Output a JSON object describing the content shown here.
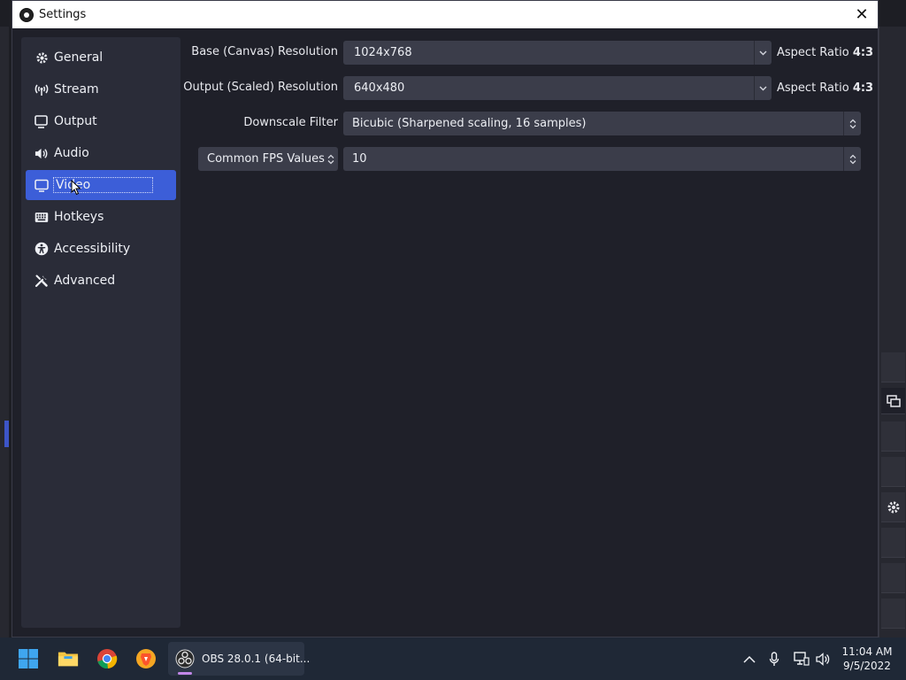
{
  "dialog": {
    "title": "Settings",
    "close_label": "✕"
  },
  "sidebar": {
    "items": [
      {
        "label": "General",
        "icon": "gear-icon"
      },
      {
        "label": "Stream",
        "icon": "broadcast-icon"
      },
      {
        "label": "Output",
        "icon": "output-icon"
      },
      {
        "label": "Audio",
        "icon": "speaker-icon"
      },
      {
        "label": "Video",
        "icon": "monitor-icon",
        "active": true
      },
      {
        "label": "Hotkeys",
        "icon": "keyboard-icon"
      },
      {
        "label": "Accessibility",
        "icon": "accessibility-icon"
      },
      {
        "label": "Advanced",
        "icon": "tools-icon"
      }
    ]
  },
  "video": {
    "base_resolution": {
      "label": "Base (Canvas) Resolution",
      "value": "1024x768",
      "aspect_prefix": "Aspect Ratio ",
      "aspect_value": "4:3"
    },
    "output_resolution": {
      "label": "Output (Scaled) Resolution",
      "value": "640x480",
      "aspect_prefix": "Aspect Ratio ",
      "aspect_value": "4:3"
    },
    "downscale_filter": {
      "label": "Downscale Filter",
      "value": "Bicubic (Sharpened scaling, 16 samples)"
    },
    "fps": {
      "type_label": "Common FPS Values",
      "value": "10"
    }
  },
  "taskbar": {
    "obs_label": "OBS 28.0.1 (64-bit...",
    "time": "11:04 AM",
    "date": "9/5/2022"
  },
  "colors": {
    "accent": "#3c5ed8",
    "dialog_bg": "#1f2029",
    "sidebar_bg": "#2a2c38",
    "input_bg": "#3b3d4a",
    "taskbar_bg": "#1f2836"
  }
}
